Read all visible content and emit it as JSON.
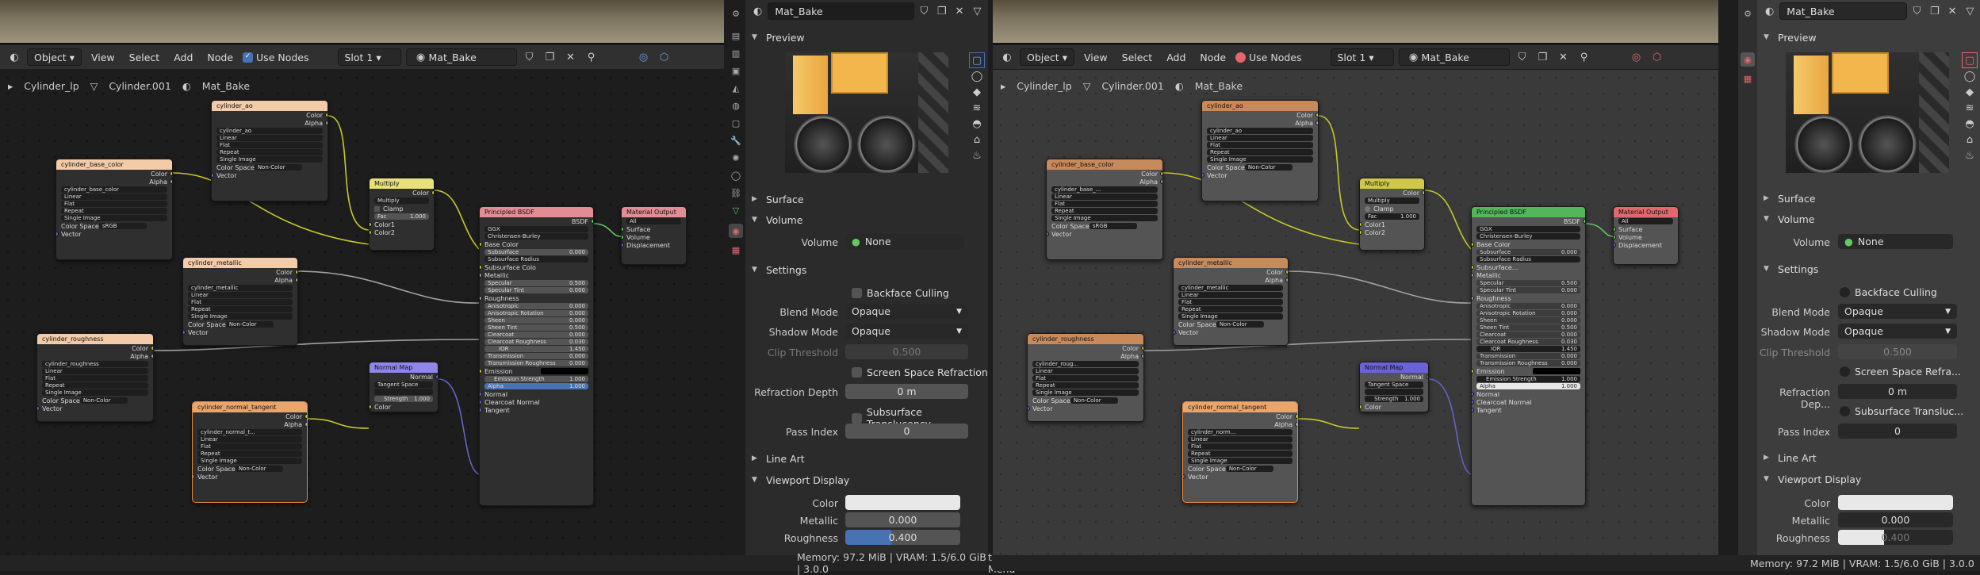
{
  "header": {
    "mode": "Object",
    "menus": [
      "View",
      "Select",
      "Add",
      "Node"
    ],
    "use_nodes": "Use Nodes",
    "slot": "Slot 1",
    "material": "Mat_Bake"
  },
  "breadcrumb": {
    "object": "Cylinder_lp",
    "mesh_left": "Cylinder.001",
    "mesh_right": "Cylinder.001",
    "material": "Mat_Bake"
  },
  "nodes": {
    "ao": {
      "title": "cylinder_ao",
      "image": "cylinder_ao"
    },
    "base": {
      "title": "cylinder_base_color",
      "image_left": "cylinder_base_color",
      "image_right": "cylinder_base_..."
    },
    "metallic": {
      "title": "cylinder_metallic",
      "image": "cylinder_metallic"
    },
    "rough": {
      "title": "cylinder_roughness",
      "image_left": "cylinder_roughness",
      "image_right": "cylinder_roug..."
    },
    "normtex": {
      "title": "cylinder_normal_tangent",
      "image_left": "cylinder_normal_t...",
      "image_right": "cylinder_norm..."
    },
    "img": {
      "color": "Color",
      "alpha": "Alpha",
      "linear": "Linear",
      "flat": "Flat",
      "repeat": "Repeat",
      "single": "Single Image",
      "cspace": "Color Space",
      "noncolor": "Non-Color",
      "srgb": "sRGB",
      "vector": "Vector"
    },
    "multiply": {
      "title": "Multiply",
      "color": "Color",
      "op": "Multiply",
      "clamp": "Clamp",
      "fac": "Fac",
      "fac_val": "1.000",
      "c1": "Color1",
      "c2": "Color2"
    },
    "normalmap": {
      "title": "Normal Map",
      "normal": "Normal",
      "space": "Tangent Space",
      "strength": "Strength",
      "strength_val": "1.000",
      "color": "Color"
    },
    "bsdf": {
      "title": "Principled BSDF",
      "bsdf": "BSDF",
      "ggx": "GGX",
      "sss": "Christensen-Burley",
      "base": "Base Color",
      "subsurface": "Subsurface",
      "subsurface_radius": "Subsurface Radius",
      "subsurface_color_left": "Subsurface Colo",
      "subsurface_color_right": "Subsurface...",
      "metallic": "Metallic",
      "specular": "Specular",
      "specular_tint": "Specular Tint",
      "roughness": "Roughness",
      "anisotropic": "Anisotropic",
      "aniso_rot": "Anisotropic Rotation",
      "sheen": "Sheen",
      "sheen_tint": "Sheen Tint",
      "clearcoat": "Clearcoat",
      "cc_rough": "Clearcoat Roughness",
      "ior": "IOR",
      "transmission": "Transmission",
      "trans_rough": "Transmission Roughness",
      "emission": "Emission",
      "em_strength": "Emission Strength",
      "alpha": "Alpha",
      "normal": "Normal",
      "cc_normal": "Clearcoat Normal",
      "tangent": "Tangent",
      "v0": "0.000",
      "v500": "0.500",
      "v030": "0.030",
      "v145": "1.450",
      "v1": "1.000"
    },
    "output": {
      "title": "Material Output",
      "target": "All",
      "surface": "Surface",
      "volume": "Volume",
      "displacement": "Displacement"
    }
  },
  "props": {
    "material": "Mat_Bake",
    "preview": "Preview",
    "surface": "Surface",
    "volume": "Volume",
    "volume_label": "Volume",
    "volume_val": "None",
    "settings": "Settings",
    "backface": "Backface Culling",
    "blend_label": "Blend Mode",
    "blend_val": "Opaque",
    "shadow_label": "Shadow Mode",
    "shadow_val": "Opaque",
    "clip_label": "Clip Threshold",
    "clip_val": "0.500",
    "ssr_left": "Screen Space Refraction",
    "ssr_right": "Screen Space Refra...",
    "refr_left": "Refraction Depth",
    "refr_right": "Refraction Dep...",
    "refr_val": "0 m",
    "sst_left": "Subsurface Translucency",
    "sst_right": "Subsurface Transluc...",
    "pass_label": "Pass Index",
    "pass_val": "0",
    "line_art": "Line Art",
    "viewport": "Viewport Display",
    "color_label": "Color",
    "metallic_label": "Metallic",
    "metallic_val": "0.000",
    "rough_label": "Roughness",
    "rough_val": "0.400"
  },
  "status": {
    "left": "Memory: 97.2 MiB | VRAM: 1.5/6.0 GiB | 3.0.0",
    "extra": "t Menu",
    "right": "Memory: 97.2 MiB | VRAM: 1.5/6.0 GiB | 3.0.0"
  },
  "colors": {
    "image_header": "#e8a66e",
    "image_header_light": "#f3cba8",
    "mix_header": "#e8e07c",
    "normal_header": "#8e86e8",
    "bsdf_header": "#e28c94",
    "bsdf_header_right": "#54b65a",
    "output_header": "#e28c94",
    "output_header_right": "#e2686e",
    "wire_color": "#c7c729",
    "wire_gray": "#a1a1a1",
    "wire_purple": "#6363c7",
    "wire_green": "#63c763"
  },
  "icons": [
    "editor-type-icon",
    "material-sphere-icon",
    "shield-icon",
    "copy-icon",
    "close-icon",
    "filter-icon",
    "pin-icon",
    "node-tree-icon",
    "mesh-icon"
  ]
}
